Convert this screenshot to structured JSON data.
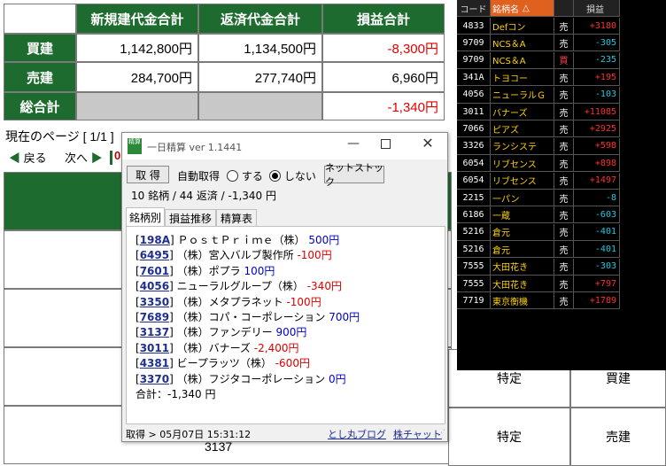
{
  "summary": {
    "headers": [
      "新規建代金合計",
      "返済代金合計",
      "損益合計"
    ],
    "rows": [
      {
        "label": "買建",
        "new": "1,142,800円",
        "repay": "1,134,500円",
        "pnl": "-8,300円"
      },
      {
        "label": "売建",
        "new": "284,700円",
        "repay": "277,740円",
        "pnl": "6,960円"
      },
      {
        "label": "総合計",
        "new": "",
        "repay": "",
        "pnl": "-1,340円"
      }
    ]
  },
  "page": {
    "current": "現在のページ [ 1/1 ]",
    "prev": "戻る",
    "next": "次へ",
    "partial": "0",
    "bottom_code": "3137"
  },
  "bottom_grid": {
    "rows": [
      {
        "type": "特定",
        "side": "買建"
      },
      {
        "type": "特定",
        "side": "売建"
      }
    ]
  },
  "ticker": {
    "headers": {
      "code": "コード",
      "name": "銘柄名",
      "sort": "△",
      "pnl": "損益"
    },
    "rows": [
      {
        "code": "4833",
        "name": "Defコン",
        "side": "売",
        "pnl": "+3180"
      },
      {
        "code": "9709",
        "name": "NCS＆A",
        "side": "売",
        "pnl": "-305"
      },
      {
        "code": "9709",
        "name": "NCS＆A",
        "side": "買",
        "pnl": "-235"
      },
      {
        "code": "341A",
        "name": "トヨコー",
        "side": "売",
        "pnl": "+195"
      },
      {
        "code": "4056",
        "name": "ニューラルＧ",
        "side": "売",
        "pnl": "-103"
      },
      {
        "code": "3011",
        "name": "バナーズ",
        "side": "売",
        "pnl": "+11085"
      },
      {
        "code": "7066",
        "name": "ピアズ",
        "side": "売",
        "pnl": "+2925"
      },
      {
        "code": "3326",
        "name": "ランシステ",
        "side": "売",
        "pnl": "+598"
      },
      {
        "code": "6054",
        "name": "リブセンス",
        "side": "売",
        "pnl": "+898"
      },
      {
        "code": "6054",
        "name": "リブセンス",
        "side": "売",
        "pnl": "+1497"
      },
      {
        "code": "2215",
        "name": "一パン",
        "side": "売",
        "pnl": "-8"
      },
      {
        "code": "6186",
        "name": "一蔵",
        "side": "売",
        "pnl": "-603"
      },
      {
        "code": "5216",
        "name": "倉元",
        "side": "売",
        "pnl": "-401"
      },
      {
        "code": "5216",
        "name": "倉元",
        "side": "売",
        "pnl": "-401"
      },
      {
        "code": "7555",
        "name": "大田花き",
        "side": "売",
        "pnl": "-303"
      },
      {
        "code": "7555",
        "name": "大田花き",
        "side": "売",
        "pnl": "+797"
      },
      {
        "code": "7719",
        "name": "東京衡機",
        "side": "売",
        "pnl": "+1789"
      }
    ]
  },
  "dialog": {
    "title": "一日精算 ver 1.1441",
    "icon_text": "精算",
    "fetch_button": "取 得",
    "auto_label": "自動取得",
    "radio_on": "する",
    "radio_off": "しない",
    "net_button": "ネットストック",
    "summary": "10 銘柄 / 44 返済 / -1,340 円",
    "tabs": [
      "銘柄別",
      "損益推移",
      "精算表"
    ],
    "items": [
      {
        "code": "198A",
        "name": "ＰｏｓｔＰｒｉｍｅ（株）",
        "amount": "500円",
        "sign": "p"
      },
      {
        "code": "6495",
        "name": "（株）宮入バルブ製作所",
        "amount": "-100円",
        "sign": "n"
      },
      {
        "code": "7601",
        "name": "（株）ポプラ",
        "amount": "100円",
        "sign": "p"
      },
      {
        "code": "4056",
        "name": "ニューラルグループ（株）",
        "amount": "-340円",
        "sign": "n"
      },
      {
        "code": "3350",
        "name": "（株）メタプラネット",
        "amount": "-100円",
        "sign": "n"
      },
      {
        "code": "7689",
        "name": "（株）コパ・コーポレーション",
        "amount": "700円",
        "sign": "p"
      },
      {
        "code": "3137",
        "name": "（株）ファンデリー",
        "amount": "900円",
        "sign": "p"
      },
      {
        "code": "3011",
        "name": "（株）バナーズ",
        "amount": "-2,400円",
        "sign": "n"
      },
      {
        "code": "4381",
        "name": "ビープラッツ（株）",
        "amount": "-600円",
        "sign": "n"
      },
      {
        "code": "3370",
        "name": "（株）フジタコーポレーション",
        "amount": "0円",
        "sign": "p"
      }
    ],
    "total": "合計：-1,340 円",
    "status": "取得 > 05月07日 15:31:12",
    "blog_link": "とし丸ブログ",
    "chart_link": "株チャット"
  },
  "colors": {
    "header_green": "#1e6b2f",
    "negative": "#e00000",
    "positive": "#0000cc"
  }
}
